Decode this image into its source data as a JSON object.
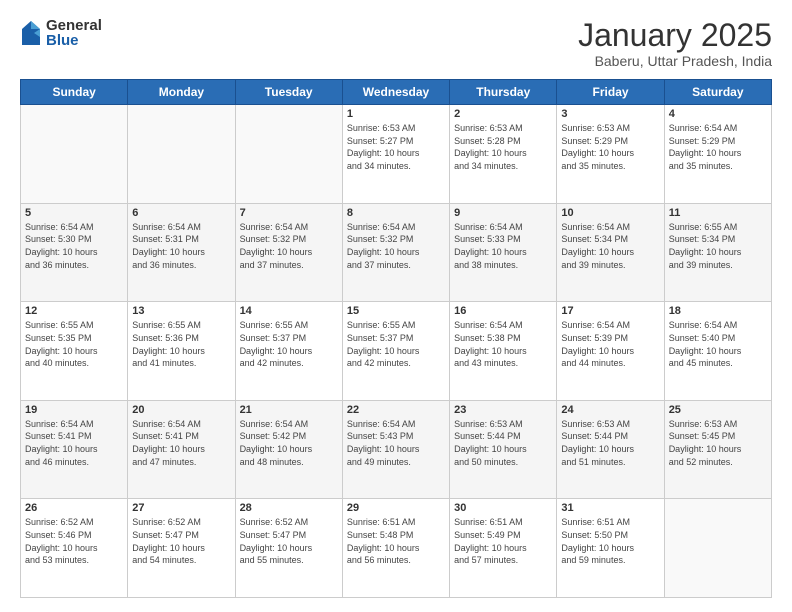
{
  "logo": {
    "general": "General",
    "blue": "Blue"
  },
  "title": "January 2025",
  "subtitle": "Baberu, Uttar Pradesh, India",
  "days_of_week": [
    "Sunday",
    "Monday",
    "Tuesday",
    "Wednesday",
    "Thursday",
    "Friday",
    "Saturday"
  ],
  "weeks": [
    [
      {
        "day": "",
        "info": ""
      },
      {
        "day": "",
        "info": ""
      },
      {
        "day": "",
        "info": ""
      },
      {
        "day": "1",
        "info": "Sunrise: 6:53 AM\nSunset: 5:27 PM\nDaylight: 10 hours\nand 34 minutes."
      },
      {
        "day": "2",
        "info": "Sunrise: 6:53 AM\nSunset: 5:28 PM\nDaylight: 10 hours\nand 34 minutes."
      },
      {
        "day": "3",
        "info": "Sunrise: 6:53 AM\nSunset: 5:29 PM\nDaylight: 10 hours\nand 35 minutes."
      },
      {
        "day": "4",
        "info": "Sunrise: 6:54 AM\nSunset: 5:29 PM\nDaylight: 10 hours\nand 35 minutes."
      }
    ],
    [
      {
        "day": "5",
        "info": "Sunrise: 6:54 AM\nSunset: 5:30 PM\nDaylight: 10 hours\nand 36 minutes."
      },
      {
        "day": "6",
        "info": "Sunrise: 6:54 AM\nSunset: 5:31 PM\nDaylight: 10 hours\nand 36 minutes."
      },
      {
        "day": "7",
        "info": "Sunrise: 6:54 AM\nSunset: 5:32 PM\nDaylight: 10 hours\nand 37 minutes."
      },
      {
        "day": "8",
        "info": "Sunrise: 6:54 AM\nSunset: 5:32 PM\nDaylight: 10 hours\nand 37 minutes."
      },
      {
        "day": "9",
        "info": "Sunrise: 6:54 AM\nSunset: 5:33 PM\nDaylight: 10 hours\nand 38 minutes."
      },
      {
        "day": "10",
        "info": "Sunrise: 6:54 AM\nSunset: 5:34 PM\nDaylight: 10 hours\nand 39 minutes."
      },
      {
        "day": "11",
        "info": "Sunrise: 6:55 AM\nSunset: 5:34 PM\nDaylight: 10 hours\nand 39 minutes."
      }
    ],
    [
      {
        "day": "12",
        "info": "Sunrise: 6:55 AM\nSunset: 5:35 PM\nDaylight: 10 hours\nand 40 minutes."
      },
      {
        "day": "13",
        "info": "Sunrise: 6:55 AM\nSunset: 5:36 PM\nDaylight: 10 hours\nand 41 minutes."
      },
      {
        "day": "14",
        "info": "Sunrise: 6:55 AM\nSunset: 5:37 PM\nDaylight: 10 hours\nand 42 minutes."
      },
      {
        "day": "15",
        "info": "Sunrise: 6:55 AM\nSunset: 5:37 PM\nDaylight: 10 hours\nand 42 minutes."
      },
      {
        "day": "16",
        "info": "Sunrise: 6:54 AM\nSunset: 5:38 PM\nDaylight: 10 hours\nand 43 minutes."
      },
      {
        "day": "17",
        "info": "Sunrise: 6:54 AM\nSunset: 5:39 PM\nDaylight: 10 hours\nand 44 minutes."
      },
      {
        "day": "18",
        "info": "Sunrise: 6:54 AM\nSunset: 5:40 PM\nDaylight: 10 hours\nand 45 minutes."
      }
    ],
    [
      {
        "day": "19",
        "info": "Sunrise: 6:54 AM\nSunset: 5:41 PM\nDaylight: 10 hours\nand 46 minutes."
      },
      {
        "day": "20",
        "info": "Sunrise: 6:54 AM\nSunset: 5:41 PM\nDaylight: 10 hours\nand 47 minutes."
      },
      {
        "day": "21",
        "info": "Sunrise: 6:54 AM\nSunset: 5:42 PM\nDaylight: 10 hours\nand 48 minutes."
      },
      {
        "day": "22",
        "info": "Sunrise: 6:54 AM\nSunset: 5:43 PM\nDaylight: 10 hours\nand 49 minutes."
      },
      {
        "day": "23",
        "info": "Sunrise: 6:53 AM\nSunset: 5:44 PM\nDaylight: 10 hours\nand 50 minutes."
      },
      {
        "day": "24",
        "info": "Sunrise: 6:53 AM\nSunset: 5:44 PM\nDaylight: 10 hours\nand 51 minutes."
      },
      {
        "day": "25",
        "info": "Sunrise: 6:53 AM\nSunset: 5:45 PM\nDaylight: 10 hours\nand 52 minutes."
      }
    ],
    [
      {
        "day": "26",
        "info": "Sunrise: 6:52 AM\nSunset: 5:46 PM\nDaylight: 10 hours\nand 53 minutes."
      },
      {
        "day": "27",
        "info": "Sunrise: 6:52 AM\nSunset: 5:47 PM\nDaylight: 10 hours\nand 54 minutes."
      },
      {
        "day": "28",
        "info": "Sunrise: 6:52 AM\nSunset: 5:47 PM\nDaylight: 10 hours\nand 55 minutes."
      },
      {
        "day": "29",
        "info": "Sunrise: 6:51 AM\nSunset: 5:48 PM\nDaylight: 10 hours\nand 56 minutes."
      },
      {
        "day": "30",
        "info": "Sunrise: 6:51 AM\nSunset: 5:49 PM\nDaylight: 10 hours\nand 57 minutes."
      },
      {
        "day": "31",
        "info": "Sunrise: 6:51 AM\nSunset: 5:50 PM\nDaylight: 10 hours\nand 59 minutes."
      },
      {
        "day": "",
        "info": ""
      }
    ]
  ]
}
